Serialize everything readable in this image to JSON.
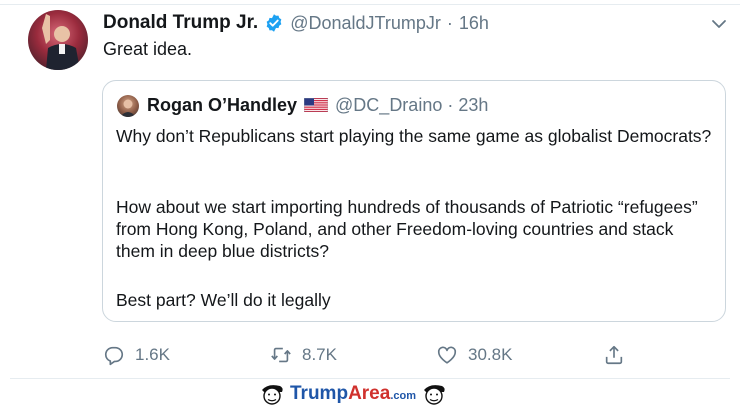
{
  "tweet": {
    "author_name": "Donald Trump Jr.",
    "handle": "@DonaldJTrumpJr",
    "separator": "·",
    "time": "16h",
    "text": "Great idea."
  },
  "quoted_tweet": {
    "author_name": "Rogan O’Handley",
    "handle": "@DC_Draino",
    "separator": "·",
    "time": "23h",
    "paragraph_1": "Why don’t Republicans start playing the same game as globalist Democrats?",
    "paragraph_2": "How about we start importing hundreds of thousands of Patriotic “refugees” from Hong Kong, Poland, and other Freedom-loving countries and stack them in deep blue districts?",
    "paragraph_3": "Best part? We’ll do it legally"
  },
  "actions": {
    "reply_count": "1.6K",
    "retweet_count": "8.7K",
    "like_count": "30.8K"
  },
  "icons": {
    "verified": "verified-badge-icon",
    "menu": "chevron-down-icon",
    "reply": "reply-icon",
    "retweet": "retweet-icon",
    "like": "heart-icon",
    "share": "share-icon",
    "flag": "us-flag-icon"
  },
  "watermark": {
    "part1": "Trump",
    "part2": "Area",
    "part3": ".com"
  },
  "colors": {
    "verified_blue": "#1da1f2",
    "secondary_text": "#657786",
    "border": "#ccd6dd",
    "watermark_blue": "#1f56a8",
    "watermark_red": "#d0312d"
  }
}
